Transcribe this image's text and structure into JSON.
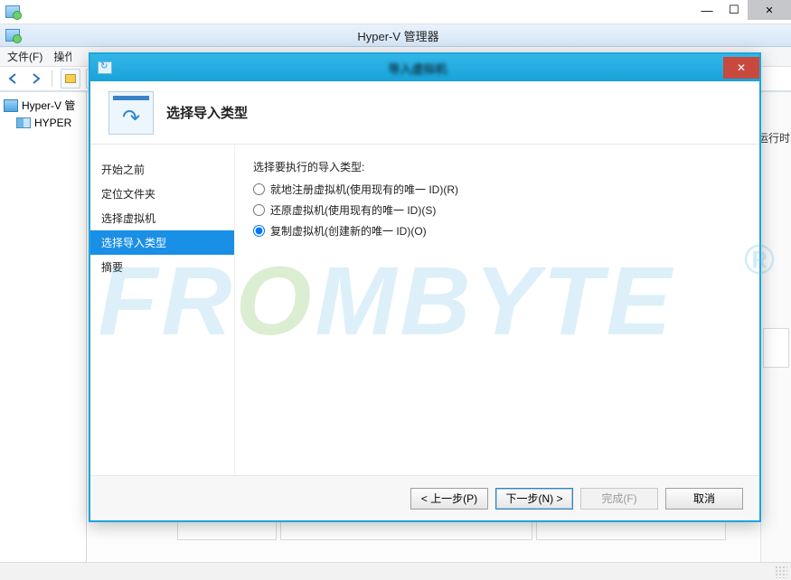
{
  "window": {
    "app_title": "Hyper-V 管理器",
    "menu": {
      "file": "文件(F)",
      "action": "操作"
    },
    "tree": {
      "root": "Hyper-V 管理器",
      "child": "HYPER"
    },
    "right_label": "运行时间"
  },
  "dialog": {
    "title": "导入虚拟机",
    "heading": "选择导入类型",
    "steps": [
      "开始之前",
      "定位文件夹",
      "选择虚拟机",
      "选择导入类型",
      "摘要"
    ],
    "active_step_index": 3,
    "prompt": "选择要执行的导入类型:",
    "options": [
      {
        "label": "就地注册虚拟机(使用现有的唯一 ID)(R)",
        "checked": false
      },
      {
        "label": "还原虚拟机(使用现有的唯一 ID)(S)",
        "checked": false
      },
      {
        "label": "复制虚拟机(创建新的唯一 ID)(O)",
        "checked": true
      }
    ],
    "buttons": {
      "back": "< 上一步(P)",
      "next": "下一步(N) >",
      "finish": "完成(F)",
      "cancel": "取消"
    }
  },
  "watermark": {
    "text": "FROMBYTE",
    "reg": "®"
  }
}
